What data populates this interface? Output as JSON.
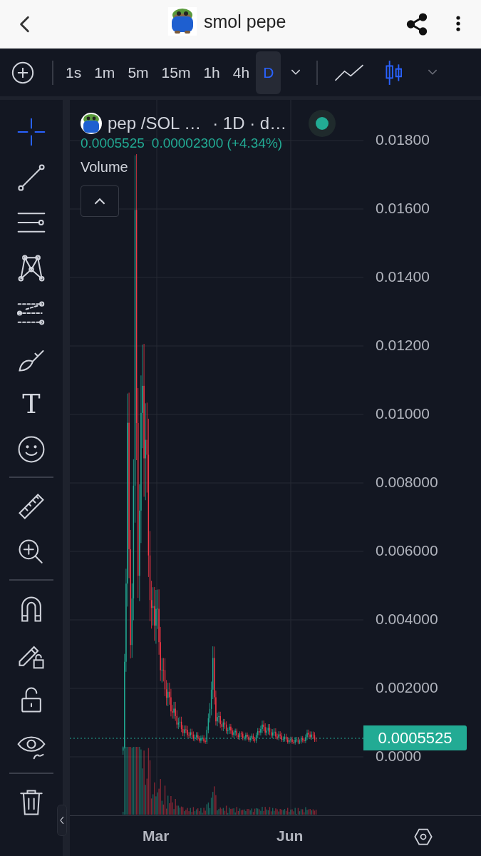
{
  "header": {
    "title": "smol pepe"
  },
  "toolbar": {
    "intervals": [
      {
        "label": "1s",
        "selected": false
      },
      {
        "label": "1m",
        "selected": false
      },
      {
        "label": "5m",
        "selected": false
      },
      {
        "label": "15m",
        "selected": false
      },
      {
        "label": "1h",
        "selected": false
      },
      {
        "label": "4h",
        "selected": false
      },
      {
        "label": "D",
        "selected": true
      }
    ],
    "chart_types": [
      {
        "kind": "line",
        "selected": false
      },
      {
        "kind": "candles",
        "selected": true
      }
    ]
  },
  "tools": [
    {
      "kind": "crosshair",
      "selected": true
    },
    {
      "kind": "trend-line",
      "selected": false
    },
    {
      "kind": "horizontal-lines",
      "selected": false
    },
    {
      "kind": "pattern",
      "selected": false
    },
    {
      "kind": "fib",
      "selected": false
    },
    {
      "kind": "brush",
      "selected": false
    },
    {
      "kind": "text",
      "glyph": "T",
      "selected": false
    },
    {
      "kind": "emoji",
      "selected": false
    },
    {
      "kind": "divider"
    },
    {
      "kind": "ruler",
      "selected": false
    },
    {
      "kind": "zoom",
      "selected": false
    },
    {
      "kind": "divider"
    },
    {
      "kind": "magnet",
      "selected": false
    },
    {
      "kind": "pencil-lock",
      "selected": false
    },
    {
      "kind": "lock",
      "selected": false
    },
    {
      "kind": "eye",
      "selected": false
    },
    {
      "kind": "divider"
    },
    {
      "kind": "trash",
      "selected": false
    }
  ],
  "legend": {
    "symbol": "pep /SOL …",
    "details": "· 1D · d…",
    "live": true,
    "last_price": "0.0005525",
    "change": "0.00002300 (+4.34%)",
    "volume_label": "Volume"
  },
  "price_axis": {
    "ticks": [
      "0.01800",
      "0.01600",
      "0.01400",
      "0.01200",
      "0.01000",
      "0.008000",
      "0.006000",
      "0.004000",
      "0.002000",
      "0.0000"
    ],
    "current_price": "0.0005525"
  },
  "time_axis": {
    "labels": [
      "Mar",
      "Jun"
    ]
  }
}
